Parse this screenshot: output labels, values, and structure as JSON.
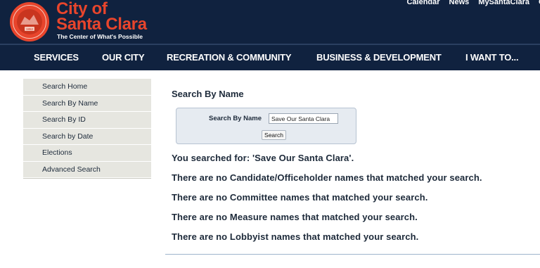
{
  "header": {
    "seal_text": "1852",
    "logo_line1": "City of",
    "logo_line2": "Santa Clara",
    "tagline": "The Center of What's Possible",
    "utility_links": [
      "Calendar",
      "News",
      "MySantaClara",
      "C"
    ]
  },
  "nav": {
    "items": [
      "SERVICES",
      "OUR CITY",
      "RECREATION & COMMUNITY",
      "BUSINESS & DEVELOPMENT",
      "I WANT TO..."
    ]
  },
  "sidebar": {
    "items": [
      "Search Home",
      "Search By Name",
      "Search By ID",
      "Search by Date",
      "Elections",
      "Advanced Search"
    ]
  },
  "main": {
    "title": "Search By Name",
    "search": {
      "label": "Search By Name",
      "value": "Save Our Santa Clara",
      "button_label": "Search"
    },
    "results": [
      "You searched for: 'Save Our Santa Clara'.",
      "There are no Candidate/Officeholder names that matched your search.",
      "There are no Committee names that matched your search.",
      "There are no Measure names that matched your search.",
      "There are no Lobbyist names that matched your search."
    ]
  },
  "colors": {
    "header_bg": "#10223f",
    "brand_orange": "#e8452c",
    "sidebar_bg": "#e6e6e0",
    "search_box_bg": "#e6ebf1"
  }
}
